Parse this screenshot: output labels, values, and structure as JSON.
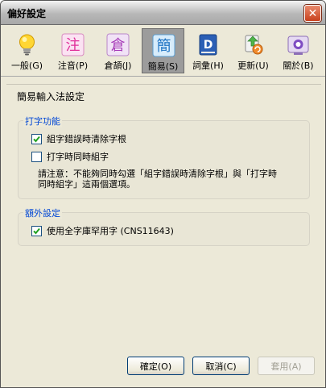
{
  "window": {
    "title": "偏好設定",
    "close_icon": "close-icon"
  },
  "tabs": [
    {
      "label": "一般(G)",
      "icon": "lightbulb-icon",
      "active": false
    },
    {
      "label": "注音(P)",
      "icon": "zhuyin-icon",
      "glyph": "注",
      "active": false
    },
    {
      "label": "倉頡(J)",
      "icon": "cangjie-icon",
      "glyph": "倉",
      "active": false
    },
    {
      "label": "簡易(S)",
      "icon": "simplex-icon",
      "glyph": "簡",
      "active": true
    },
    {
      "label": "詞彙(H)",
      "icon": "dictionary-icon",
      "glyph": "D",
      "active": false
    },
    {
      "label": "更新(U)",
      "icon": "update-icon",
      "active": false
    },
    {
      "label": "關於(B)",
      "icon": "about-icon",
      "active": false
    }
  ],
  "panel": {
    "heading": "簡易輸入法設定",
    "typing_group": {
      "label": "打字功能",
      "option1": {
        "label": "組字錯誤時清除字根",
        "checked": true
      },
      "option2": {
        "label": "打字時同時組字",
        "checked": false
      },
      "note_line1": "請注意：不能夠同時勾選「組字錯誤時清除字根」與「打字時",
      "note_line2": "同時組字」這兩個選項。"
    },
    "extra_group": {
      "label": "額外設定",
      "option1": {
        "label": "使用全字庫罕用字 (CNS11643)",
        "checked": true
      }
    }
  },
  "buttons": {
    "ok": "確定(O)",
    "cancel": "取消(C)",
    "apply": "套用(A)"
  },
  "colors": {
    "accent": "#0046d5",
    "window_bg": "#ece9d8",
    "active_tab_bg": "#9c9c9c",
    "close_red": "#c8411d"
  }
}
